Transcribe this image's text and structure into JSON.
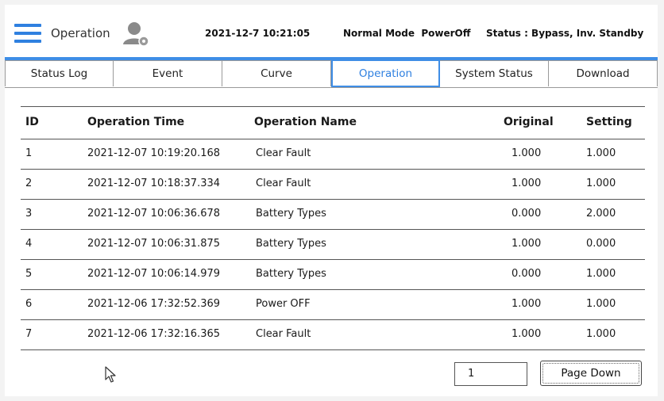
{
  "header": {
    "title": "Operation",
    "datetime": "2021-12-7 10:21:05",
    "mode": "Normal Mode  PowerOff",
    "status": "Status : Bypass, Inv. Standby",
    "icons": {
      "menu": "hamburger-menu-icon",
      "user": "user-settings-icon"
    },
    "accent_color": "#3f8ee6"
  },
  "tabs": [
    {
      "label": "Status Log",
      "active": false
    },
    {
      "label": "Event",
      "active": false
    },
    {
      "label": "Curve",
      "active": false
    },
    {
      "label": "Operation",
      "active": true
    },
    {
      "label": "System Status",
      "active": false
    },
    {
      "label": "Download",
      "active": false
    }
  ],
  "table": {
    "headers": {
      "id": "ID",
      "time": "Operation Time",
      "name": "Operation Name",
      "original": "Original",
      "setting": "Setting"
    },
    "rows": [
      {
        "id": "1",
        "time": "2021-12-07 10:19:20.168",
        "name": "Clear Fault",
        "original": "1.000",
        "setting": "1.000"
      },
      {
        "id": "2",
        "time": "2021-12-07 10:18:37.334",
        "name": "Clear Fault",
        "original": "1.000",
        "setting": "1.000"
      },
      {
        "id": "3",
        "time": "2021-12-07 10:06:36.678",
        "name": "Battery Types",
        "original": "0.000",
        "setting": "2.000"
      },
      {
        "id": "4",
        "time": "2021-12-07 10:06:31.875",
        "name": "Battery Types",
        "original": "1.000",
        "setting": "0.000"
      },
      {
        "id": "5",
        "time": "2021-12-07 10:06:14.979",
        "name": "Battery Types",
        "original": "0.000",
        "setting": "1.000"
      },
      {
        "id": "6",
        "time": "2021-12-06 17:32:52.369",
        "name": "Power OFF",
        "original": "1.000",
        "setting": "1.000"
      },
      {
        "id": "7",
        "time": "2021-12-06 17:32:16.365",
        "name": "Clear Fault",
        "original": "1.000",
        "setting": "1.000"
      }
    ]
  },
  "footer": {
    "page_number": "1",
    "page_down_label": "Page Down"
  }
}
